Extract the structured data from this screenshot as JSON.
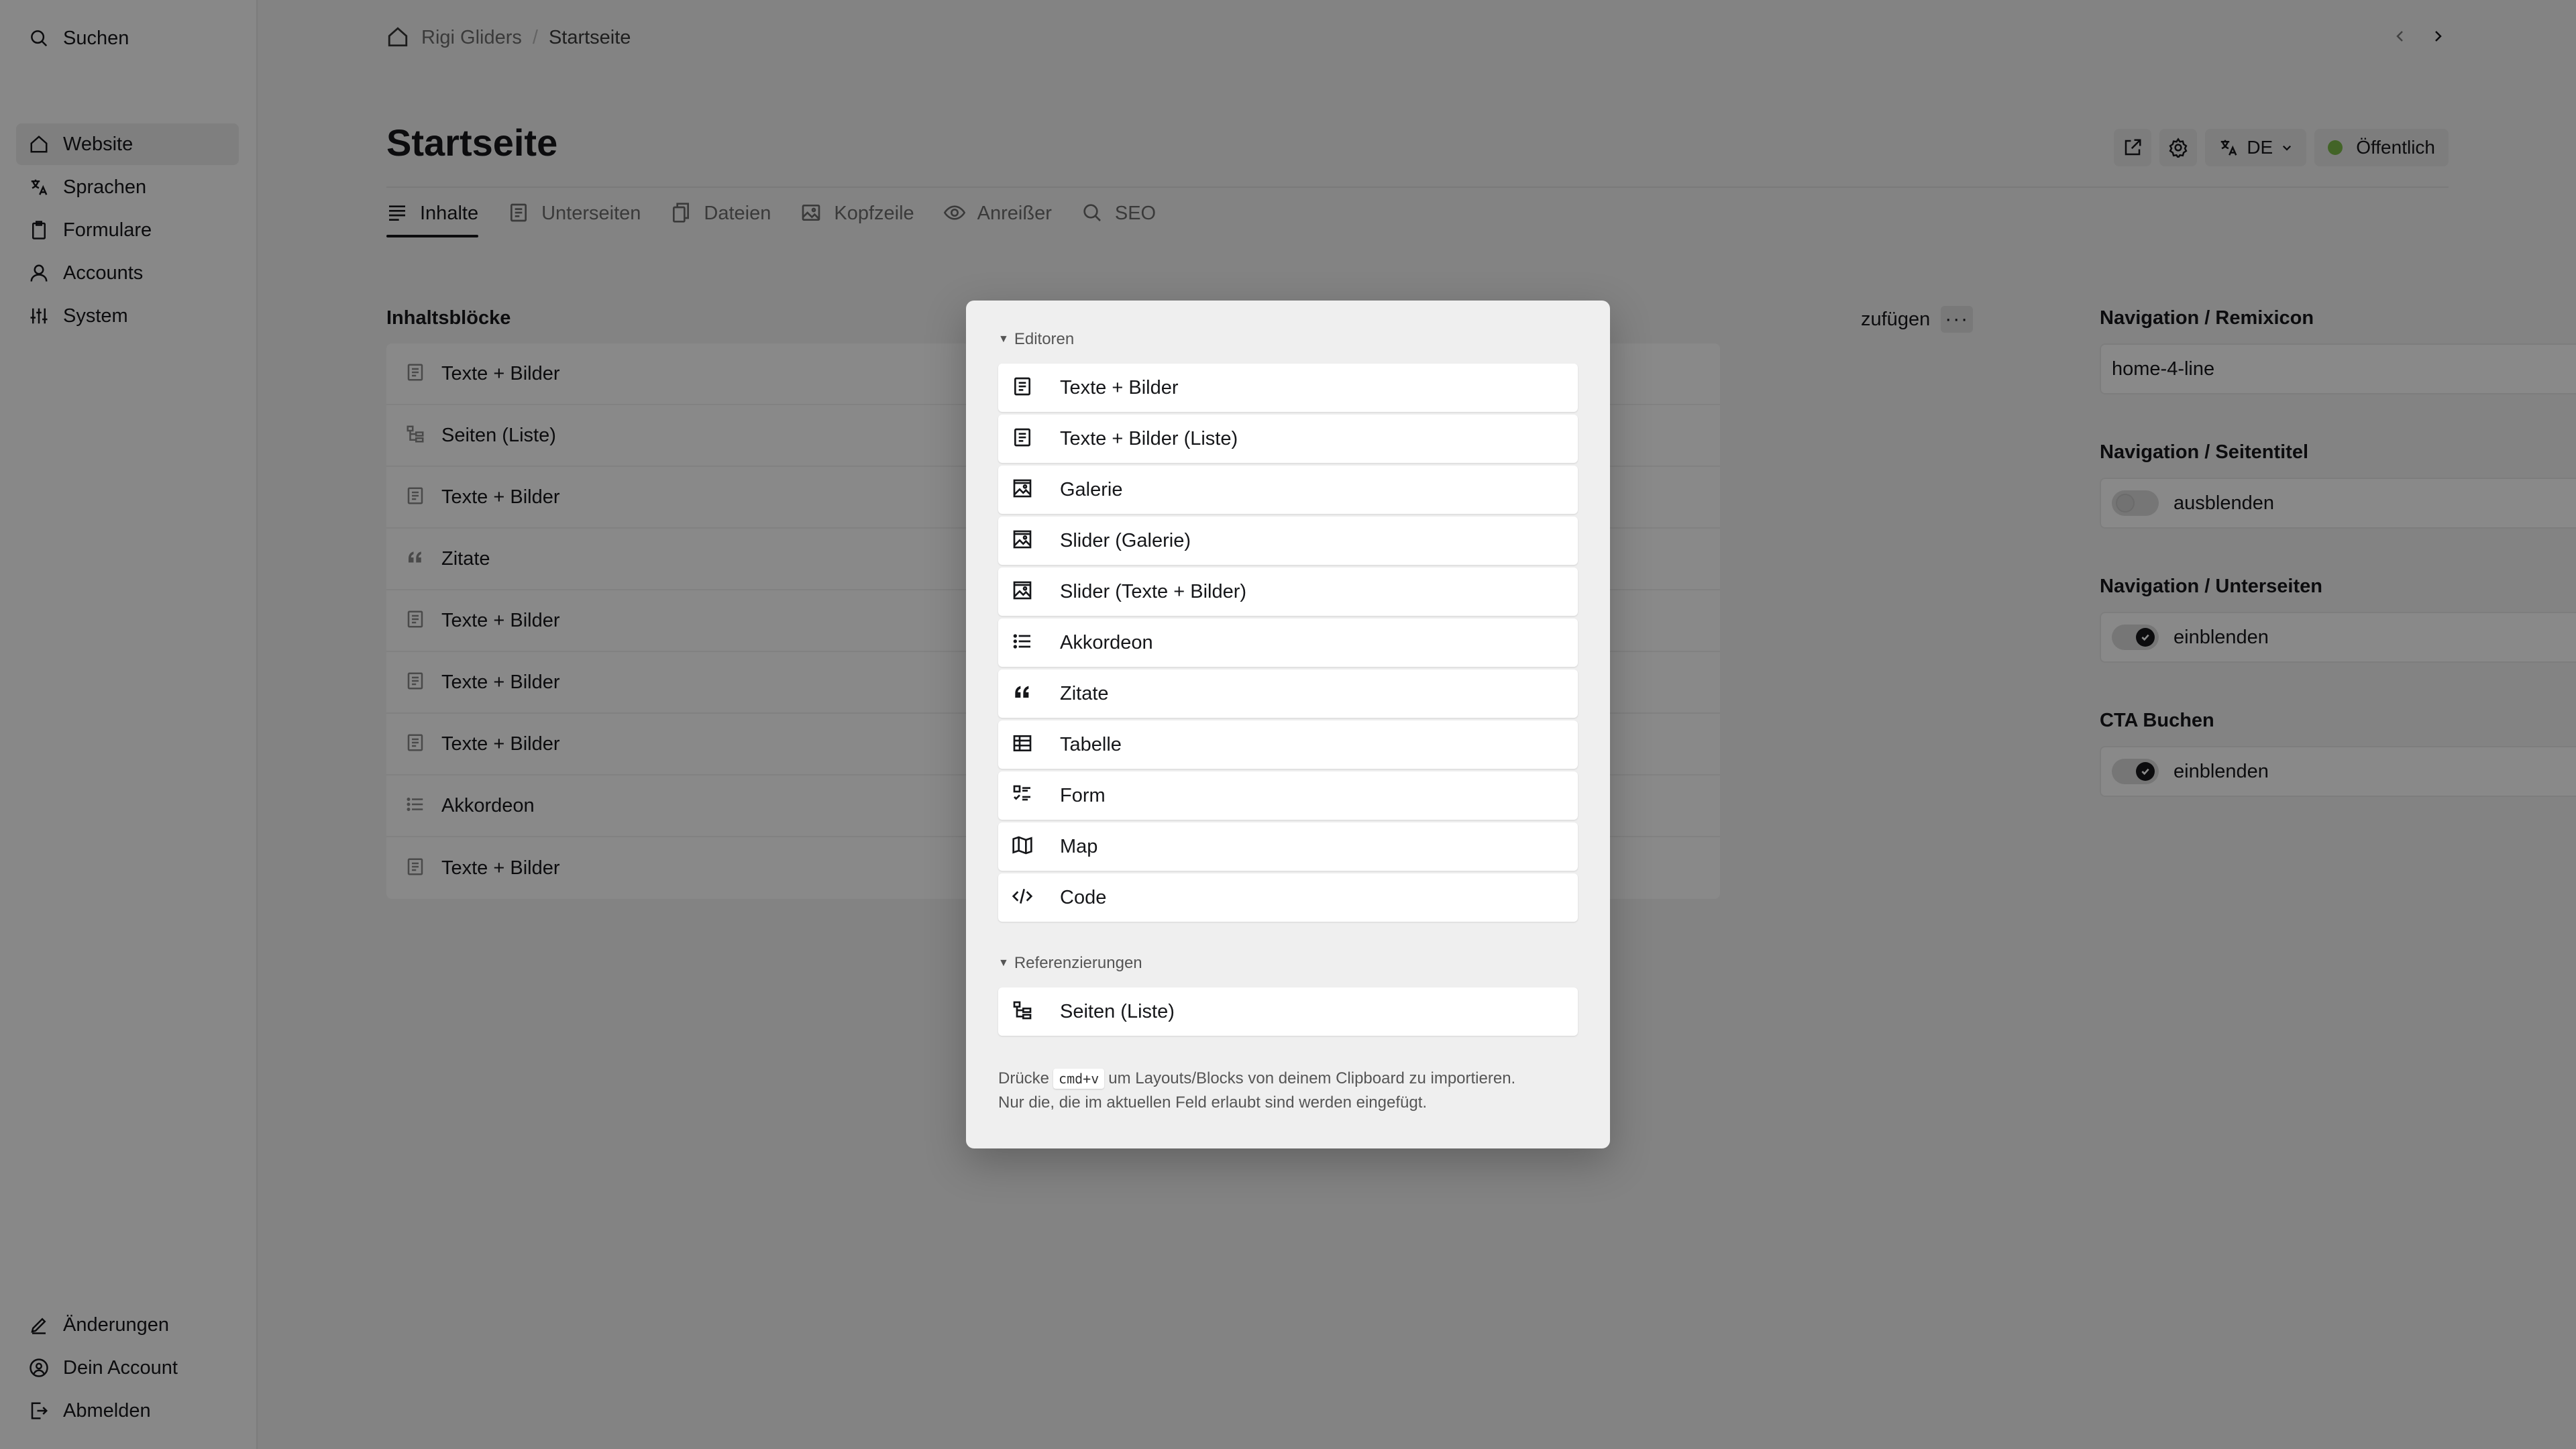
{
  "sidebar": {
    "search_label": "Suchen",
    "menu": [
      {
        "label": "Website",
        "icon": "home-icon",
        "active": true
      },
      {
        "label": "Sprachen",
        "icon": "translate-icon"
      },
      {
        "label": "Formulare",
        "icon": "clipboard-icon"
      },
      {
        "label": "Accounts",
        "icon": "user-icon"
      },
      {
        "label": "System",
        "icon": "settings-sliders-icon"
      }
    ],
    "footer": [
      {
        "label": "Änderungen",
        "icon": "pencil-icon"
      },
      {
        "label": "Dein Account",
        "icon": "account-circle-icon"
      },
      {
        "label": "Abmelden",
        "icon": "logout-icon"
      }
    ]
  },
  "breadcrumb": {
    "site": "Rigi Gliders",
    "separator": "/",
    "current": "Startseite"
  },
  "page": {
    "title": "Startseite",
    "language": "DE",
    "status": "Öffentlich",
    "status_color": "#7ab648"
  },
  "tabs": [
    {
      "label": "Inhalte",
      "icon": "text-lines-icon",
      "active": true
    },
    {
      "label": "Unterseiten",
      "icon": "page-icon"
    },
    {
      "label": "Dateien",
      "icon": "files-icon"
    },
    {
      "label": "Kopfzeile",
      "icon": "image-icon"
    },
    {
      "label": "Anreißer",
      "icon": "eye-icon"
    },
    {
      "label": "SEO",
      "icon": "search-icon"
    }
  ],
  "blocks": {
    "label": "Inhaltsblöcke",
    "add_label_partial": "zufügen",
    "more_label": "···",
    "items": [
      {
        "label": "Texte + Bilder",
        "icon": "text-block-icon"
      },
      {
        "label": "Seiten (Liste)",
        "icon": "tree-icon"
      },
      {
        "label": "Texte + Bilder",
        "icon": "text-block-icon"
      },
      {
        "label": "Zitate",
        "icon": "quote-icon"
      },
      {
        "label": "Texte + Bilder",
        "icon": "text-block-icon"
      },
      {
        "label": "Texte + Bilder",
        "icon": "text-block-icon"
      },
      {
        "label": "Texte + Bilder",
        "icon": "text-block-icon"
      },
      {
        "label": "Akkordeon",
        "icon": "list-icon"
      },
      {
        "label": "Texte + Bilder",
        "icon": "text-block-icon"
      }
    ]
  },
  "fields": {
    "remixicon": {
      "label": "Navigation / Remixicon",
      "value": "home-4-line"
    },
    "seitentitel": {
      "label": "Navigation / Seitentitel",
      "value": "ausblenden",
      "on": false
    },
    "unterseiten": {
      "label": "Navigation / Unterseiten",
      "value": "einblenden",
      "on": true
    },
    "cta": {
      "label": "CTA Buchen",
      "value": "einblenden",
      "on": true
    }
  },
  "dialog": {
    "group1_title": "Editoren",
    "group1": [
      {
        "label": "Texte + Bilder",
        "icon": "text-block-icon"
      },
      {
        "label": "Texte + Bilder (Liste)",
        "icon": "text-block-icon"
      },
      {
        "label": "Galerie",
        "icon": "gallery-icon"
      },
      {
        "label": "Slider (Galerie)",
        "icon": "gallery-icon"
      },
      {
        "label": "Slider (Texte + Bilder)",
        "icon": "gallery-icon"
      },
      {
        "label": "Akkordeon",
        "icon": "list-icon"
      },
      {
        "label": "Zitate",
        "icon": "quote-icon"
      },
      {
        "label": "Tabelle",
        "icon": "table-icon"
      },
      {
        "label": "Form",
        "icon": "form-icon"
      },
      {
        "label": "Map",
        "icon": "map-icon"
      },
      {
        "label": "Code",
        "icon": "code-icon"
      }
    ],
    "group2_title": "Referenzierungen",
    "group2": [
      {
        "label": "Seiten (Liste)",
        "icon": "tree-icon"
      }
    ],
    "hint_pre": "Drücke",
    "hint_key": "cmd+v",
    "hint_post": "um Layouts/Blocks von deinem Clipboard zu importieren.",
    "hint_line2": "Nur die, die im aktuellen Feld erlaubt sind werden eingefügt."
  }
}
